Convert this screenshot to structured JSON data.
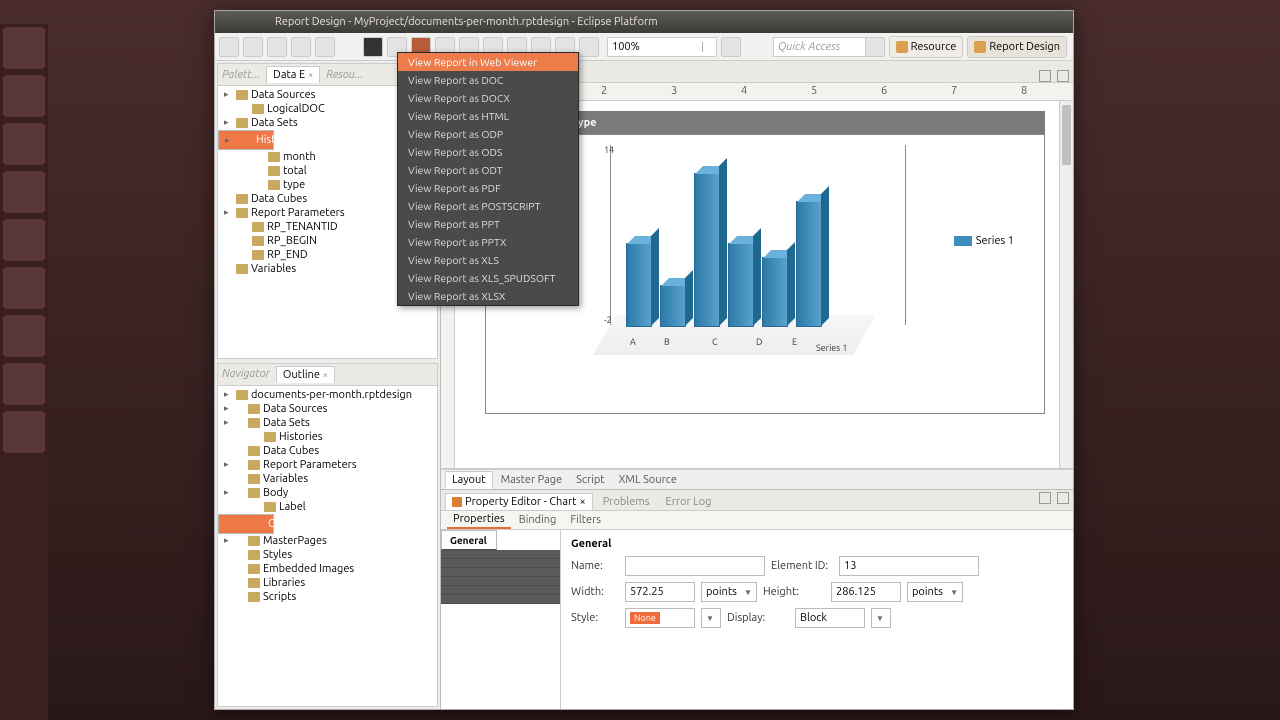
{
  "window_title": "Report Design - MyProject/documents-per-month.rptdesign - Eclipse Platform",
  "zoom": "100%",
  "quick_access": "Quick Access",
  "perspectives": {
    "resource": "Resource",
    "report_design": "Report Design"
  },
  "data_view": {
    "tab": "Data E",
    "ghost_tab": "Resou...",
    "palette": "Palett...",
    "nodes": {
      "data_sources": "Data Sources",
      "logicaldoc": "LogicalDOC",
      "data_sets": "Data Sets",
      "histories": "Histories",
      "month": "month",
      "total": "total",
      "type": "type",
      "data_cubes": "Data Cubes",
      "report_parameters": "Report Parameters",
      "rp_tenant": "RP_TENANTID",
      "rp_begin": "RP_BEGIN",
      "rp_end": "RP_END",
      "variables": "Variables"
    }
  },
  "outline": {
    "title": "Outline",
    "nav": "Navigator",
    "nodes": {
      "root": "documents-per-month.rptdesign",
      "data_sources": "Data Sources",
      "data_sets": "Data Sets",
      "histories": "Histories",
      "data_cubes": "Data Cubes",
      "report_parameters": "Report Parameters",
      "variables": "Variables",
      "body": "Body",
      "label": "Label",
      "chart": "Chart",
      "master_pages": "MasterPages",
      "styles": "Styles",
      "embedded_images": "Embedded Images",
      "libraries": "Libraries",
      "scripts": "Scripts"
    }
  },
  "editor": {
    "filename": "rptdesign",
    "report_heading": "per month and type",
    "bottom_tabs": {
      "layout": "Layout",
      "master": "Master Page",
      "script": "Script",
      "xml": "XML Source"
    }
  },
  "legend": "Series 1",
  "series_label": "Series 1",
  "chart_data": {
    "type": "bar",
    "categories": [
      "A",
      "B",
      "C",
      "D",
      "E"
    ],
    "values": [
      6,
      3,
      11,
      6,
      5,
      9
    ],
    "ylim_left": [
      0,
      14
    ],
    "ylim_right": [
      2,
      14
    ],
    "legend": [
      "Series 1"
    ]
  },
  "menu": {
    "items": [
      "View Report in Web Viewer",
      "View Report as DOC",
      "View Report as DOCX",
      "View Report as HTML",
      "View Report as ODP",
      "View Report as ODS",
      "View Report as ODT",
      "View Report as PDF",
      "View Report as POSTSCRIPT",
      "View Report as PPT",
      "View Report as PPTX",
      "View Report as XLS",
      "View Report as XLS_SPUDSOFT",
      "View Report as XLSX"
    ]
  },
  "props": {
    "title": "Property Editor - Chart",
    "problems": "Problems",
    "errorlog": "Error Log",
    "subtabs": {
      "properties": "Properties",
      "binding": "Binding",
      "filters": "Filters"
    },
    "cats": [
      "General",
      "",
      "",
      "",
      "",
      "",
      ""
    ],
    "general": "General",
    "name_lbl": "Name:",
    "elid_lbl": "Element ID:",
    "elid": "13",
    "width_lbl": "Width:",
    "width": "572.25",
    "height_lbl": "Height:",
    "height": "286.125",
    "unit": "points",
    "style_lbl": "Style:",
    "style_none": "None",
    "display_lbl": "Display:",
    "display": "Block"
  }
}
